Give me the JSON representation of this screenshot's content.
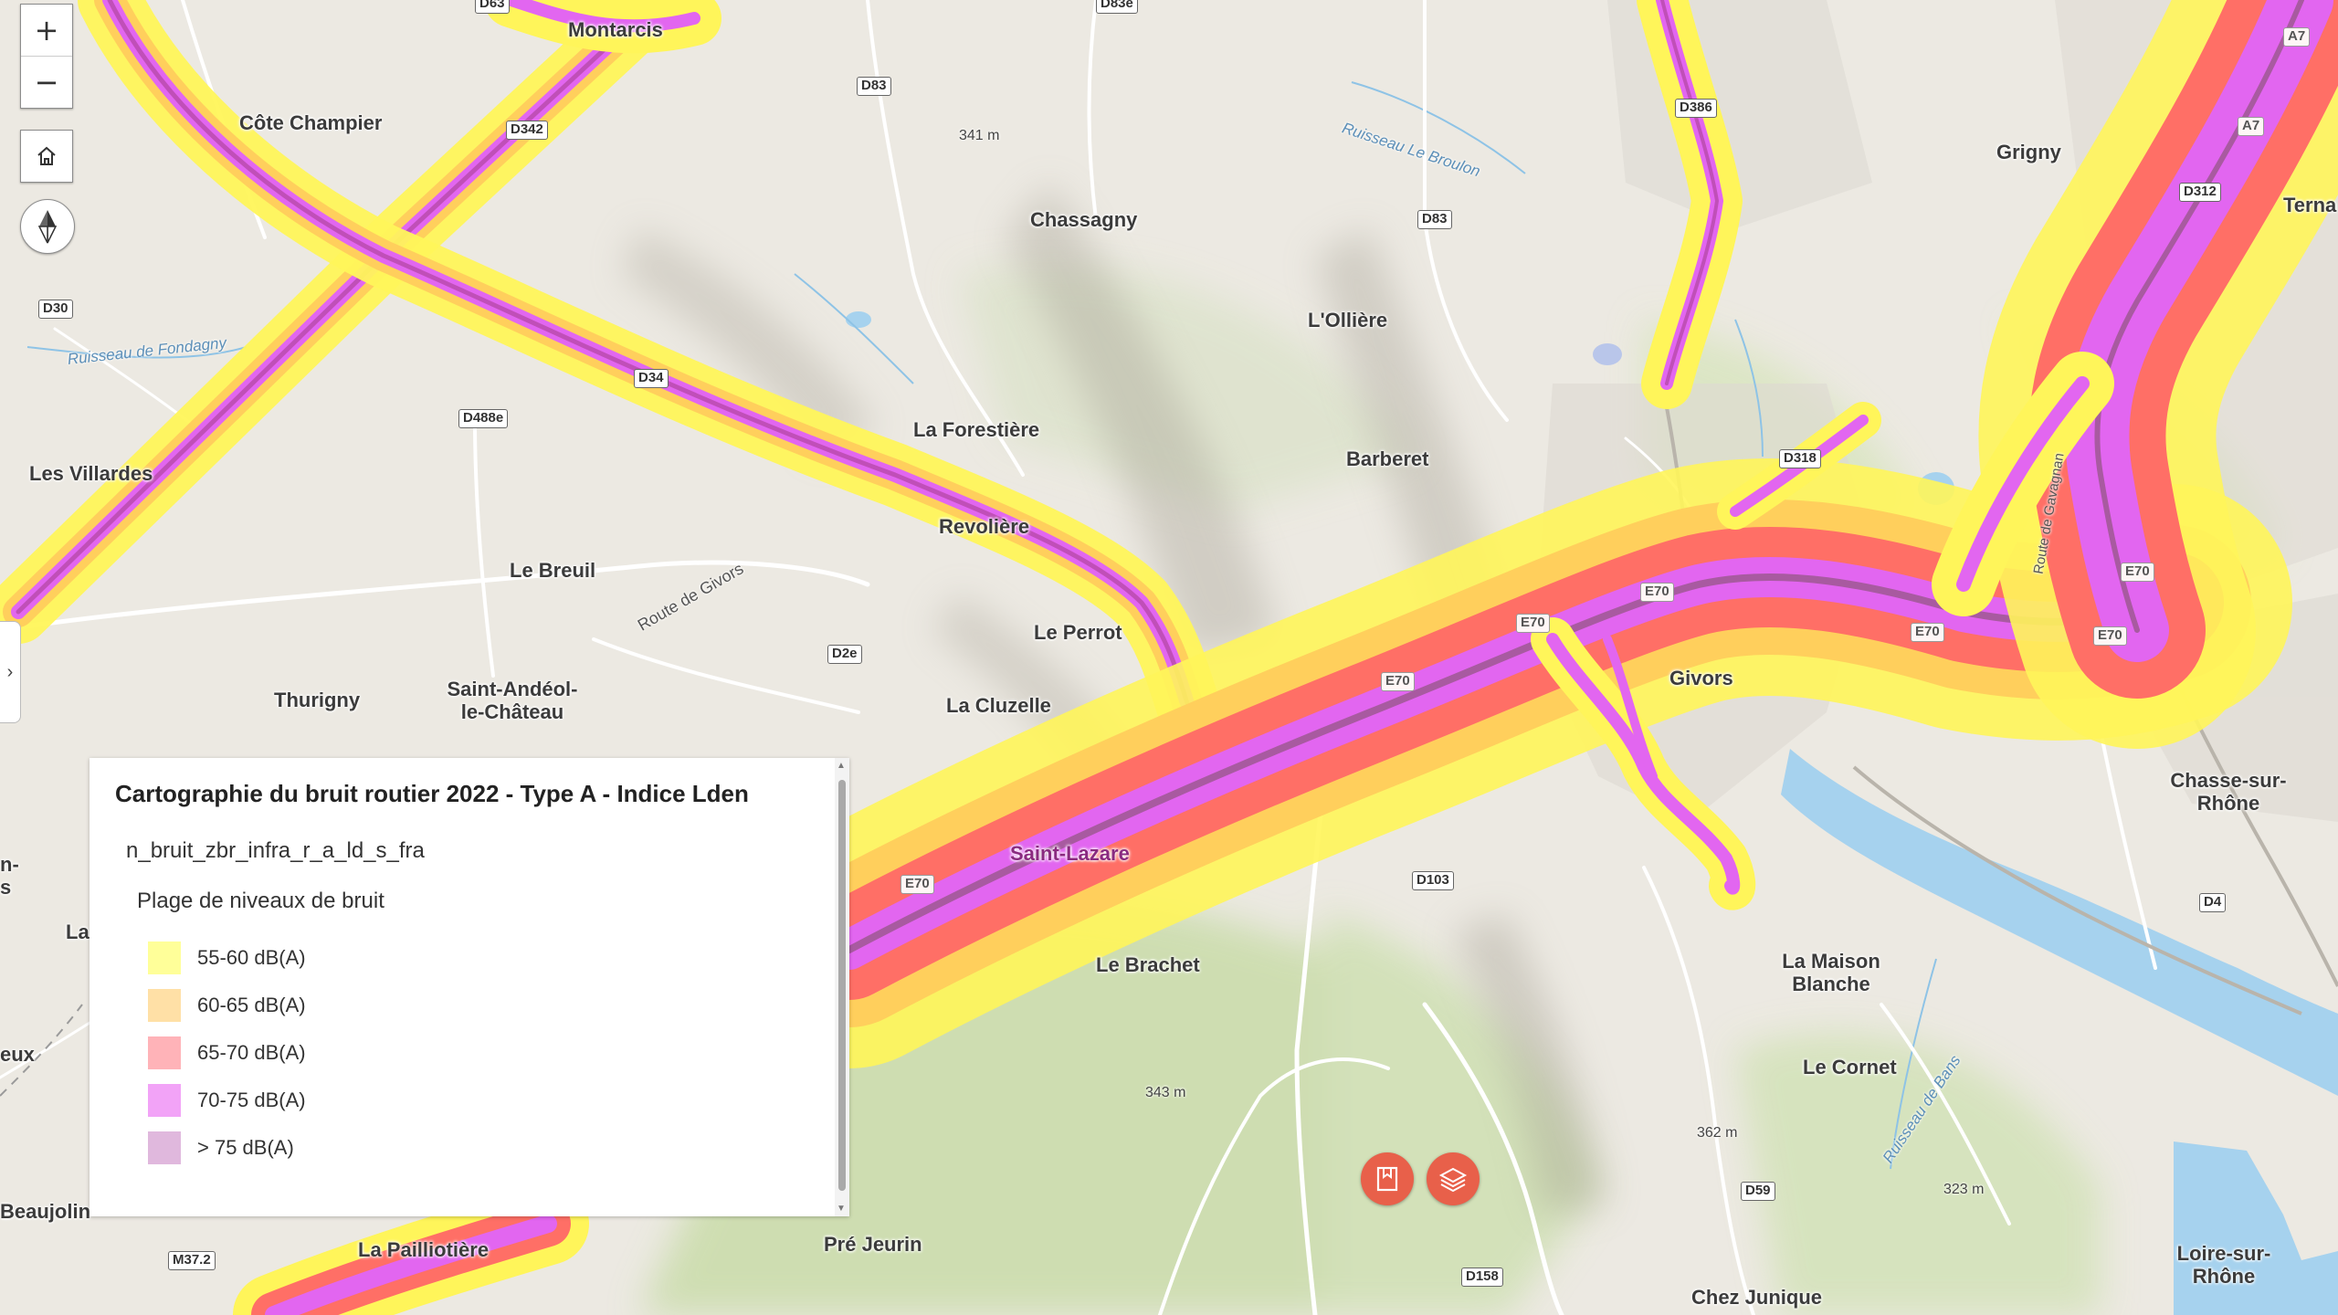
{
  "map": {
    "places": [
      {
        "id": "montarcis",
        "label": "Montarcis"
      },
      {
        "id": "cote-champier",
        "label": "Côte Champier"
      },
      {
        "id": "chassagny",
        "label": "Chassagny"
      },
      {
        "id": "grigny",
        "label": "Grigny"
      },
      {
        "id": "terna",
        "label": "Terna"
      },
      {
        "id": "lolliere",
        "label": "L'Ollière"
      },
      {
        "id": "la-forestiere",
        "label": "La Forestière"
      },
      {
        "id": "barberet",
        "label": "Barberet"
      },
      {
        "id": "les-villardes",
        "label": "Les Villardes"
      },
      {
        "id": "revoliere",
        "label": "Revolière"
      },
      {
        "id": "le-breuil",
        "label": "Le Breuil"
      },
      {
        "id": "le-perrot",
        "label": "Le Perrot"
      },
      {
        "id": "thurigny",
        "label": "Thurigny"
      },
      {
        "id": "saint-andeol",
        "label": "Saint-Andéol-\nle-Château"
      },
      {
        "id": "la-cluzelle",
        "label": "La Cluzelle"
      },
      {
        "id": "givors",
        "label": "Givors"
      },
      {
        "id": "chasse-sur-rhone",
        "label": "Chasse-sur-\nRhône"
      },
      {
        "id": "saint-lazare",
        "label": "Saint-Lazare"
      },
      {
        "id": "le-brachet",
        "label": "Le Brachet"
      },
      {
        "id": "la-maison-blanche",
        "label": "La Maison\nBlanche"
      },
      {
        "id": "le-cornet",
        "label": "Le Cornet"
      },
      {
        "id": "la-pailliotiere",
        "label": "La Pailliotière"
      },
      {
        "id": "pre-jeurin",
        "label": "Pré Jeurin"
      },
      {
        "id": "chez-junique",
        "label": "Chez Junique"
      },
      {
        "id": "loire-sur-rhone",
        "label": "Loire-sur-\nRhône"
      },
      {
        "id": "beaujolin",
        "label": "Beaujolin"
      },
      {
        "id": "n-s",
        "label": "n-\ns"
      },
      {
        "id": "la-left",
        "label": "La"
      },
      {
        "id": "eux",
        "label": "eux"
      }
    ],
    "elevations": [
      {
        "id": "e341",
        "label": "341 m"
      },
      {
        "id": "e343",
        "label": "343 m"
      },
      {
        "id": "e362",
        "label": "362 m"
      },
      {
        "id": "e323",
        "label": "323 m"
      }
    ],
    "road_shields": [
      {
        "id": "d63",
        "label": "D63"
      },
      {
        "id": "d83e",
        "label": "D83e"
      },
      {
        "id": "d83",
        "label": "D83"
      },
      {
        "id": "d342",
        "label": "D342"
      },
      {
        "id": "d386",
        "label": "D386"
      },
      {
        "id": "d83b",
        "label": "D83"
      },
      {
        "id": "d30",
        "label": "D30"
      },
      {
        "id": "d34",
        "label": "D34"
      },
      {
        "id": "d488e",
        "label": "D488e"
      },
      {
        "id": "d318",
        "label": "D318"
      },
      {
        "id": "a7a",
        "label": "A7"
      },
      {
        "id": "a7b",
        "label": "A7"
      },
      {
        "id": "d312",
        "label": "D312"
      },
      {
        "id": "d2e",
        "label": "D2e"
      },
      {
        "id": "e70a",
        "label": "E70"
      },
      {
        "id": "e70b",
        "label": "E70"
      },
      {
        "id": "e70c",
        "label": "E70"
      },
      {
        "id": "e70d",
        "label": "E70"
      },
      {
        "id": "e70e",
        "label": "E70"
      },
      {
        "id": "e70f",
        "label": "E70"
      },
      {
        "id": "e70g",
        "label": "E70"
      },
      {
        "id": "d103",
        "label": "D103"
      },
      {
        "id": "d4",
        "label": "D4"
      },
      {
        "id": "d59",
        "label": "D59"
      },
      {
        "id": "d158",
        "label": "D158"
      },
      {
        "id": "m372",
        "label": "M37.2"
      }
    ],
    "water_labels": [
      {
        "id": "ruisseau-broulon",
        "label": "Ruisseau Le Broulon"
      },
      {
        "id": "ruisseau-fondagny",
        "label": "Ruisseau de Fondagny"
      },
      {
        "id": "route-givors",
        "label": "Route de Givors"
      },
      {
        "id": "ruisseau-bans",
        "label": "Ruisseau de Bans"
      },
      {
        "id": "route-gr",
        "label": "Route de Gavagnan"
      }
    ]
  },
  "controls": {
    "zoom_in": "+",
    "zoom_out": "−",
    "side_toggle": "›"
  },
  "legend": {
    "title": "Cartographie du bruit routier 2022 - Type A - Indice Lden",
    "layer_name": "n_bruit_zbr_infra_r_a_ld_s_fra",
    "subtitle": "Plage de niveaux de bruit",
    "items": [
      {
        "label": "55-60 dB(A)",
        "color": "#ffff99"
      },
      {
        "label": "60-65 dB(A)",
        "color": "#ffe0a6"
      },
      {
        "label": "65-70 dB(A)",
        "color": "#ffb3b8"
      },
      {
        "label": "70-75 dB(A)",
        "color": "#f2a3f7"
      },
      {
        "label": "> 75 dB(A)",
        "color": "#e0b8dd"
      }
    ]
  },
  "noise_colors": {
    "band_55_60": "#fff55a",
    "band_60_65": "#ffcf5c",
    "band_65_70": "#ff6f66",
    "band_70_75": "#e266f0",
    "band_75": "#c04fb8"
  },
  "fab_color": "#e8604a"
}
